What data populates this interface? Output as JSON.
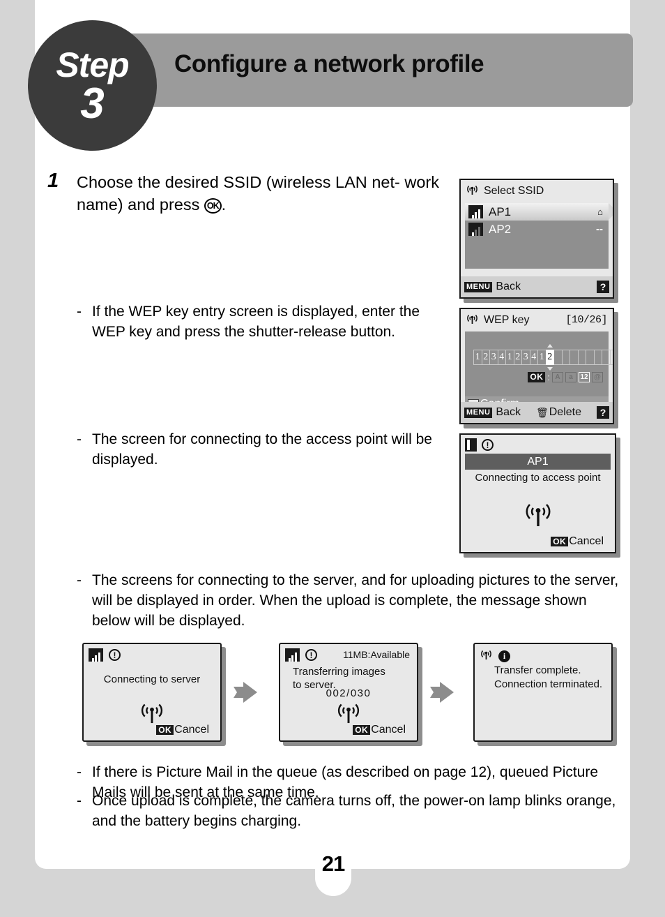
{
  "page": {
    "number": "21",
    "step_word": "Step",
    "step_number": "3",
    "header_title": "Configure a network profile"
  },
  "step1": {
    "index": "1",
    "text_line1": "Choose the desired SSID (wireless LAN net-",
    "text_line2_pre": "work name) and press ",
    "ok_glyph": "OK",
    "text_line2_post": "."
  },
  "bullets": {
    "dash": "-",
    "b1": "If the WEP key entry screen is displayed, enter the WEP key and press the shutter-release button.",
    "b2": "The screen for connecting to the access point will be displayed.",
    "b3": "The screens for connecting to the server, and for uploading pictures to the server, will be displayed in order. When the upload is complete, the message shown below will be displayed.",
    "b4": "If there is Picture Mail in the queue (as described on page 12), queued Picture Mails will be sent at the same time.",
    "b5": "Once upload is complete, the camera turns off, the power-on lamp blinks orange, and the battery begins charging."
  },
  "ssid_screen": {
    "title": "Select SSID",
    "wifi_icon": "wifi-antenna-icon",
    "rows": [
      {
        "name": "AP1",
        "right": "⌂",
        "selected": true
      },
      {
        "name": "AP2",
        "right": "--",
        "selected": false
      }
    ],
    "menu_badge": "MENU",
    "back_label": "Back",
    "help_badge": "?"
  },
  "wep_screen": {
    "title": "WEP key",
    "counter": "[10/26]",
    "key_chars": [
      "1",
      "2",
      "3",
      "4",
      "1",
      "2",
      "3",
      "4",
      "1",
      "2"
    ],
    "cursor_index": 9,
    "total_cells": 18,
    "ok_badge": "OK",
    "mode_separator": ":",
    "modes": [
      {
        "label": "A",
        "active": false
      },
      {
        "label": "a",
        "active": false
      },
      {
        "label": "12",
        "active": true
      },
      {
        "label": "@",
        "active": false
      }
    ],
    "confirm_label": "Confirm",
    "menu_badge": "MENU",
    "back_label": "Back",
    "delete_label": "Delete",
    "help_badge": "?"
  },
  "ap_screen": {
    "signal_icon": "signal-strength-icon",
    "warning_icon": "exclamation-icon",
    "ap_name": "AP1",
    "message": "Connecting to access point",
    "wifi_icon": "wifi-transmit-icon",
    "ok_badge": "OK",
    "cancel_label": "Cancel"
  },
  "mini_screens": [
    {
      "signal_icon": "signal-strength-icon",
      "warning_icon": "exclamation-icon",
      "message": "Connecting to server",
      "wifi_icon": "wifi-transmit-icon",
      "ok_badge": "OK",
      "cancel_label": "Cancel"
    },
    {
      "signal_icon": "signal-strength-icon",
      "warning_icon": "exclamation-icon",
      "available": "11MB:Available",
      "message_line1": "Transferring images",
      "message_line2": "to server.",
      "counter": "002/030",
      "wifi_icon": "wifi-transmit-icon",
      "ok_badge": "OK",
      "cancel_label": "Cancel"
    },
    {
      "wifi_icon": "wifi-antenna-icon",
      "info_icon": "info-icon",
      "message_line1": "Transfer complete.",
      "message_line2": "Connection terminated."
    }
  ],
  "arrows": {
    "icon": "right-arrow-icon"
  },
  "colors": {
    "page_background": "#d5d5d5",
    "panel": "#ffffff",
    "header_bar": "#9b9b9b",
    "step_badge": "#3b3b3b",
    "lcd_background": "#e8e8e8",
    "lcd_body": "#8f8f8f",
    "arrow": "#8c8c8c"
  }
}
